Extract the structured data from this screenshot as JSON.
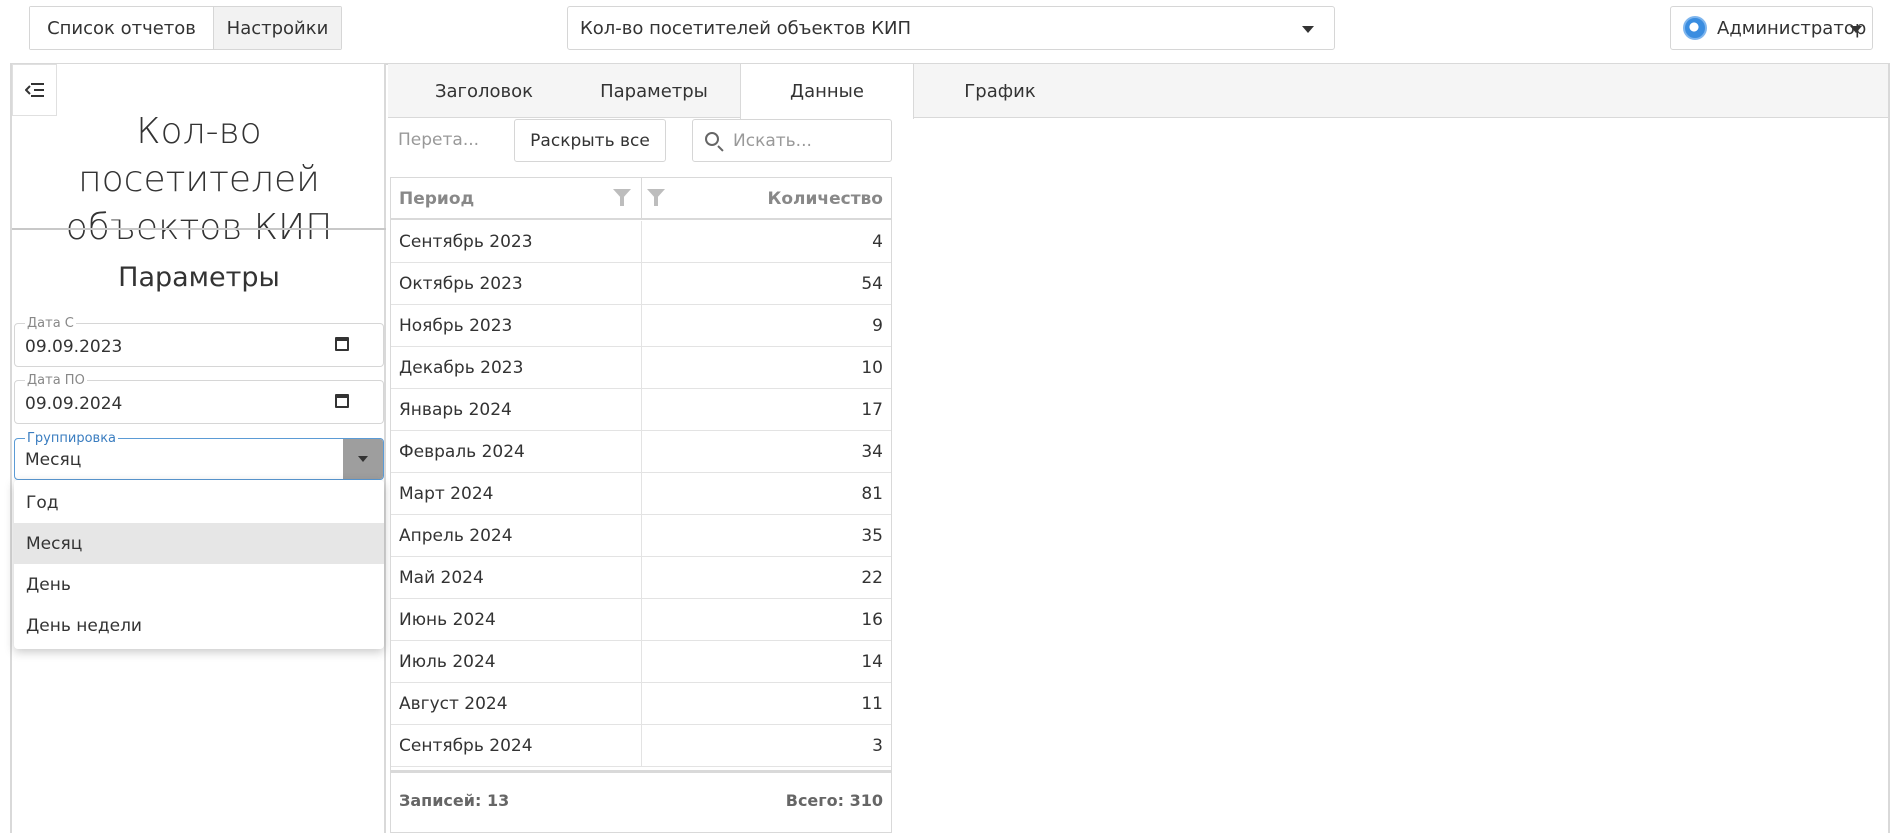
{
  "nav": {
    "reports_list": "Список отчетов",
    "settings": "Настройки"
  },
  "report_selector": {
    "value": "Кол-во посетителей объектов КИП"
  },
  "user": {
    "name": "Администратор"
  },
  "sidebar": {
    "title": "Кол-во посетителей объектов КИП",
    "params_heading": "Параметры",
    "date_from": {
      "label": "Дата С",
      "value": "09.09.2023"
    },
    "date_to": {
      "label": "Дата ПО",
      "value": "09.09.2024"
    },
    "grouping": {
      "label": "Группировка",
      "value": "Месяц",
      "options": [
        "Год",
        "Месяц",
        "День",
        "День недели"
      ]
    }
  },
  "tabs": [
    "Заголовок",
    "Параметры",
    "Данные",
    "График"
  ],
  "toolbar": {
    "drag_hint": "Перета...",
    "expand_all": "Раскрыть все",
    "search_placeholder": "Искать..."
  },
  "grid": {
    "columns": [
      "Период",
      "Количество"
    ],
    "rows": [
      {
        "period": "Сентябрь 2023",
        "qty": "4"
      },
      {
        "period": "Октябрь 2023",
        "qty": "54"
      },
      {
        "period": "Ноябрь 2023",
        "qty": "9"
      },
      {
        "period": "Декабрь 2023",
        "qty": "10"
      },
      {
        "period": "Январь 2024",
        "qty": "17"
      },
      {
        "period": "Февраль 2024",
        "qty": "34"
      },
      {
        "period": "Март 2024",
        "qty": "81"
      },
      {
        "period": "Апрель 2024",
        "qty": "35"
      },
      {
        "period": "Май 2024",
        "qty": "22"
      },
      {
        "period": "Июнь 2024",
        "qty": "16"
      },
      {
        "period": "Июль 2024",
        "qty": "14"
      },
      {
        "period": "Август 2024",
        "qty": "11"
      },
      {
        "period": "Сентябрь 2024",
        "qty": "3"
      }
    ],
    "footer": {
      "records": "Записей: 13",
      "total": "Всего: 310"
    }
  },
  "colors": {
    "accent": "#5b9bd5",
    "border": "#d9d9d9"
  }
}
